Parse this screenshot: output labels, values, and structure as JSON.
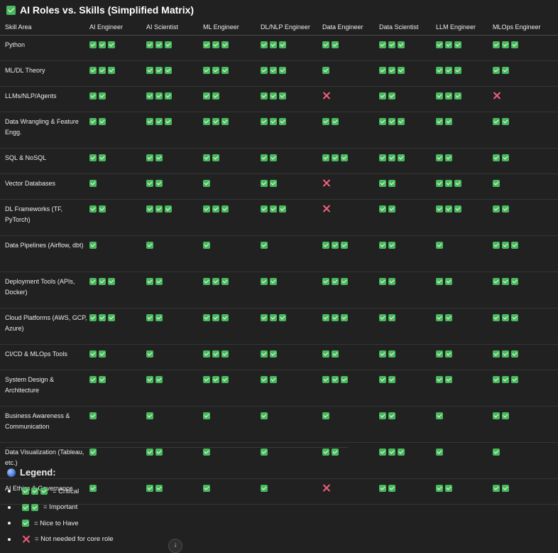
{
  "title": "AI Roles vs. Skills (Simplified Matrix)",
  "columns": [
    "Skill Area",
    "AI Engineer",
    "AI Scientist",
    "ML Engineer",
    "DL/NLP Engineer",
    "Data Engineer",
    "Data Scientist",
    "LLM Engineer",
    "MLOps Engineer"
  ],
  "rows": [
    {
      "skill": "Python",
      "values": [
        3,
        3,
        3,
        3,
        2,
        3,
        3,
        3
      ]
    },
    {
      "skill": "ML/DL Theory",
      "values": [
        3,
        3,
        3,
        3,
        1,
        3,
        3,
        2
      ]
    },
    {
      "skill": "LLMs/NLP/Agents",
      "values": [
        2,
        3,
        2,
        3,
        0,
        2,
        3,
        0
      ]
    },
    {
      "skill": "Data Wrangling & Feature Engg.",
      "values": [
        2,
        3,
        3,
        3,
        2,
        3,
        2,
        2
      ]
    },
    {
      "skill": "SQL & NoSQL",
      "values": [
        2,
        2,
        2,
        2,
        3,
        3,
        2,
        2
      ]
    },
    {
      "skill": "Vector Databases",
      "values": [
        1,
        2,
        1,
        2,
        0,
        2,
        3,
        1
      ]
    },
    {
      "skill": "DL Frameworks (TF, PyTorch)",
      "values": [
        2,
        3,
        3,
        3,
        0,
        2,
        3,
        2
      ]
    },
    {
      "skill": "Data Pipelines (Airflow, dbt)",
      "values": [
        1,
        1,
        1,
        1,
        3,
        2,
        1,
        3
      ]
    },
    {
      "skill": "Deployment Tools (APIs, Docker)",
      "values": [
        3,
        2,
        3,
        2,
        3,
        2,
        2,
        3
      ]
    },
    {
      "skill": "Cloud Platforms (AWS, GCP, Azure)",
      "values": [
        3,
        2,
        3,
        3,
        3,
        2,
        2,
        3
      ]
    },
    {
      "skill": "CI/CD & MLOps Tools",
      "values": [
        2,
        1,
        3,
        2,
        2,
        2,
        2,
        3
      ]
    },
    {
      "skill": "System Design & Architecture",
      "values": [
        2,
        2,
        3,
        2,
        3,
        2,
        2,
        3
      ]
    },
    {
      "skill": "Business Awareness & Communication",
      "values": [
        1,
        1,
        1,
        1,
        1,
        2,
        1,
        2
      ]
    },
    {
      "skill": "Data Visualization (Tableau, etc.)",
      "values": [
        1,
        2,
        1,
        1,
        2,
        3,
        1,
        1
      ]
    },
    {
      "skill": "AI Ethics & Governance",
      "values": [
        1,
        2,
        1,
        1,
        0,
        2,
        2,
        2
      ]
    }
  ],
  "legend": {
    "title": "Legend:",
    "items": [
      {
        "level": 3,
        "label": "= Critical"
      },
      {
        "level": 2,
        "label": "= Important"
      },
      {
        "level": 1,
        "label": "= Nice to Have"
      },
      {
        "level": 0,
        "label": "= Not needed for core role"
      }
    ]
  },
  "colors": {
    "check": "#48b95c",
    "cross": "#f2607a",
    "background": "#212121"
  }
}
